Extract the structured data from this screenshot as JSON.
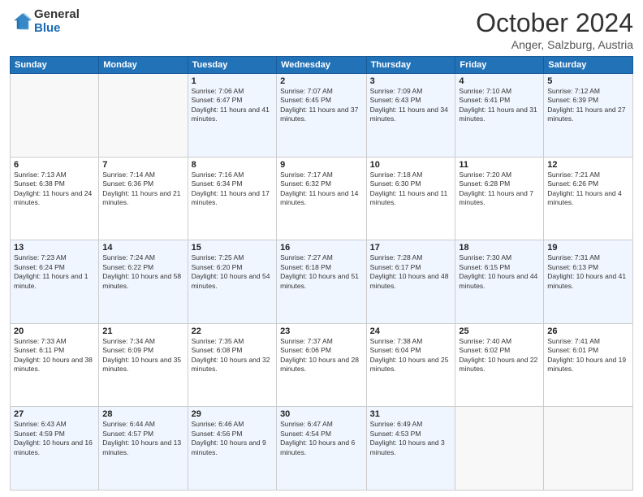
{
  "header": {
    "logo_general": "General",
    "logo_blue": "Blue",
    "title": "October 2024",
    "location": "Anger, Salzburg, Austria"
  },
  "weekdays": [
    "Sunday",
    "Monday",
    "Tuesday",
    "Wednesday",
    "Thursday",
    "Friday",
    "Saturday"
  ],
  "weeks": [
    [
      {
        "day": "",
        "info": ""
      },
      {
        "day": "",
        "info": ""
      },
      {
        "day": "1",
        "info": "Sunrise: 7:06 AM\nSunset: 6:47 PM\nDaylight: 11 hours and 41 minutes."
      },
      {
        "day": "2",
        "info": "Sunrise: 7:07 AM\nSunset: 6:45 PM\nDaylight: 11 hours and 37 minutes."
      },
      {
        "day": "3",
        "info": "Sunrise: 7:09 AM\nSunset: 6:43 PM\nDaylight: 11 hours and 34 minutes."
      },
      {
        "day": "4",
        "info": "Sunrise: 7:10 AM\nSunset: 6:41 PM\nDaylight: 11 hours and 31 minutes."
      },
      {
        "day": "5",
        "info": "Sunrise: 7:12 AM\nSunset: 6:39 PM\nDaylight: 11 hours and 27 minutes."
      }
    ],
    [
      {
        "day": "6",
        "info": "Sunrise: 7:13 AM\nSunset: 6:38 PM\nDaylight: 11 hours and 24 minutes."
      },
      {
        "day": "7",
        "info": "Sunrise: 7:14 AM\nSunset: 6:36 PM\nDaylight: 11 hours and 21 minutes."
      },
      {
        "day": "8",
        "info": "Sunrise: 7:16 AM\nSunset: 6:34 PM\nDaylight: 11 hours and 17 minutes."
      },
      {
        "day": "9",
        "info": "Sunrise: 7:17 AM\nSunset: 6:32 PM\nDaylight: 11 hours and 14 minutes."
      },
      {
        "day": "10",
        "info": "Sunrise: 7:18 AM\nSunset: 6:30 PM\nDaylight: 11 hours and 11 minutes."
      },
      {
        "day": "11",
        "info": "Sunrise: 7:20 AM\nSunset: 6:28 PM\nDaylight: 11 hours and 7 minutes."
      },
      {
        "day": "12",
        "info": "Sunrise: 7:21 AM\nSunset: 6:26 PM\nDaylight: 11 hours and 4 minutes."
      }
    ],
    [
      {
        "day": "13",
        "info": "Sunrise: 7:23 AM\nSunset: 6:24 PM\nDaylight: 11 hours and 1 minute."
      },
      {
        "day": "14",
        "info": "Sunrise: 7:24 AM\nSunset: 6:22 PM\nDaylight: 10 hours and 58 minutes."
      },
      {
        "day": "15",
        "info": "Sunrise: 7:25 AM\nSunset: 6:20 PM\nDaylight: 10 hours and 54 minutes."
      },
      {
        "day": "16",
        "info": "Sunrise: 7:27 AM\nSunset: 6:18 PM\nDaylight: 10 hours and 51 minutes."
      },
      {
        "day": "17",
        "info": "Sunrise: 7:28 AM\nSunset: 6:17 PM\nDaylight: 10 hours and 48 minutes."
      },
      {
        "day": "18",
        "info": "Sunrise: 7:30 AM\nSunset: 6:15 PM\nDaylight: 10 hours and 44 minutes."
      },
      {
        "day": "19",
        "info": "Sunrise: 7:31 AM\nSunset: 6:13 PM\nDaylight: 10 hours and 41 minutes."
      }
    ],
    [
      {
        "day": "20",
        "info": "Sunrise: 7:33 AM\nSunset: 6:11 PM\nDaylight: 10 hours and 38 minutes."
      },
      {
        "day": "21",
        "info": "Sunrise: 7:34 AM\nSunset: 6:09 PM\nDaylight: 10 hours and 35 minutes."
      },
      {
        "day": "22",
        "info": "Sunrise: 7:35 AM\nSunset: 6:08 PM\nDaylight: 10 hours and 32 minutes."
      },
      {
        "day": "23",
        "info": "Sunrise: 7:37 AM\nSunset: 6:06 PM\nDaylight: 10 hours and 28 minutes."
      },
      {
        "day": "24",
        "info": "Sunrise: 7:38 AM\nSunset: 6:04 PM\nDaylight: 10 hours and 25 minutes."
      },
      {
        "day": "25",
        "info": "Sunrise: 7:40 AM\nSunset: 6:02 PM\nDaylight: 10 hours and 22 minutes."
      },
      {
        "day": "26",
        "info": "Sunrise: 7:41 AM\nSunset: 6:01 PM\nDaylight: 10 hours and 19 minutes."
      }
    ],
    [
      {
        "day": "27",
        "info": "Sunrise: 6:43 AM\nSunset: 4:59 PM\nDaylight: 10 hours and 16 minutes."
      },
      {
        "day": "28",
        "info": "Sunrise: 6:44 AM\nSunset: 4:57 PM\nDaylight: 10 hours and 13 minutes."
      },
      {
        "day": "29",
        "info": "Sunrise: 6:46 AM\nSunset: 4:56 PM\nDaylight: 10 hours and 9 minutes."
      },
      {
        "day": "30",
        "info": "Sunrise: 6:47 AM\nSunset: 4:54 PM\nDaylight: 10 hours and 6 minutes."
      },
      {
        "day": "31",
        "info": "Sunrise: 6:49 AM\nSunset: 4:53 PM\nDaylight: 10 hours and 3 minutes."
      },
      {
        "day": "",
        "info": ""
      },
      {
        "day": "",
        "info": ""
      }
    ]
  ]
}
